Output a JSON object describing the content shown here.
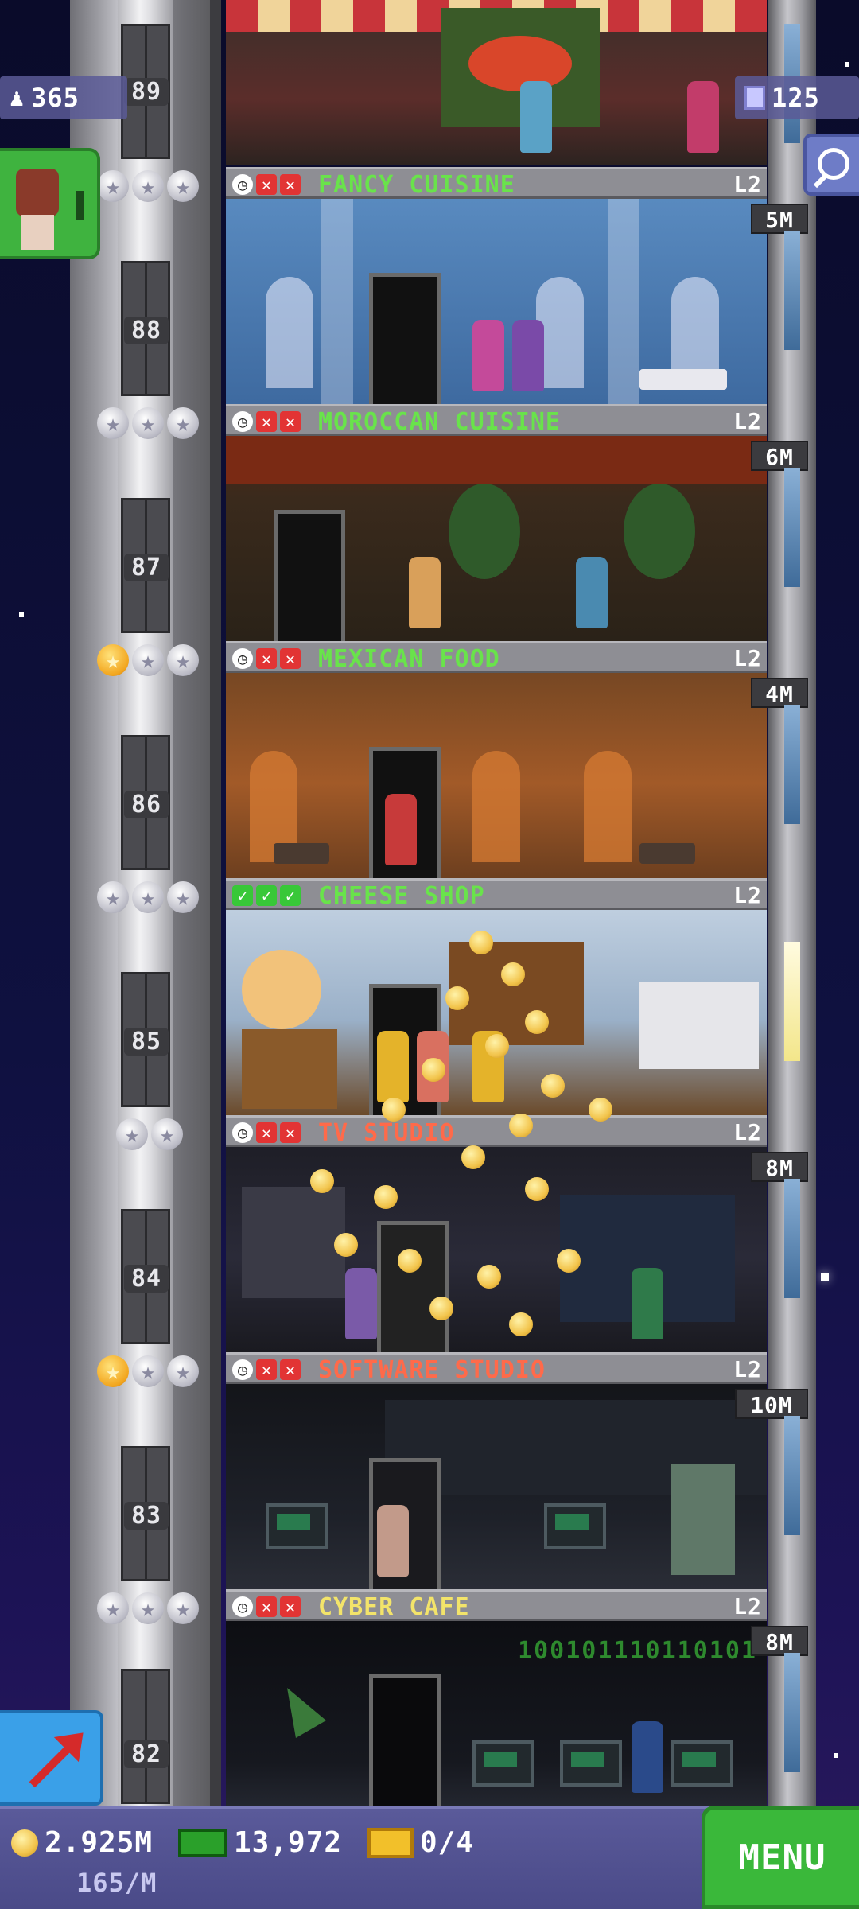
{
  "hud": {
    "population": "365",
    "bux": "125"
  },
  "floors": [
    {
      "number": "89"
    },
    {
      "number": "88",
      "name": "FANCY CUISINE",
      "level": "L2",
      "income": "5M",
      "status": [
        "clock",
        "x",
        "x"
      ],
      "stars": [
        "silver",
        "silver",
        "silver"
      ],
      "name_color": "green"
    },
    {
      "number": "87",
      "name": "MOROCCAN CUISINE",
      "level": "L2",
      "income": "6M",
      "status": [
        "clock",
        "x",
        "x"
      ],
      "stars": [
        "silver",
        "silver",
        "silver"
      ],
      "name_color": "green"
    },
    {
      "number": "86",
      "name": "MEXICAN FOOD",
      "level": "L2",
      "income": "4M",
      "status": [
        "clock",
        "x",
        "x"
      ],
      "stars": [
        "gold",
        "silver",
        "silver"
      ],
      "name_color": "green"
    },
    {
      "number": "85",
      "name": "CHEESE SHOP",
      "level": "L2",
      "income": "",
      "status": [
        "check",
        "check",
        "check"
      ],
      "stars": [
        "silver",
        "silver",
        "silver"
      ],
      "name_color": "green"
    },
    {
      "number": "84",
      "name": "TV STUDIO",
      "level": "L2",
      "income": "8M",
      "status": [
        "clock",
        "x",
        "x"
      ],
      "stars": [
        "silver",
        "silver"
      ],
      "name_color": "red"
    },
    {
      "number": "83",
      "name": "SOFTWARE STUDIO",
      "level": "L2",
      "income": "10M",
      "status": [
        "clock",
        "x",
        "x"
      ],
      "stars": [
        "gold",
        "silver",
        "silver"
      ],
      "name_color": "red"
    },
    {
      "number": "82",
      "name": "CYBER CAFE",
      "level": "L2",
      "income": "8M",
      "status": [
        "clock",
        "x",
        "x"
      ],
      "stars": [
        "silver",
        "silver",
        "silver"
      ],
      "name_color": "yellow"
    }
  ],
  "cyber_display": "100101110110101",
  "footer": {
    "coins": "2.925M",
    "coin_rate": "165/M",
    "bux": "13,972",
    "tickets": "0/4",
    "menu_label": "MENU"
  },
  "icons": {
    "population": "person-icon",
    "bux": "building-icon",
    "search": "magnifier-icon",
    "arrow": "red-arrow-icon",
    "coin": "coin-icon",
    "cash": "cash-icon",
    "ticket": "gold-ticket-icon"
  },
  "colors": {
    "green_name": "#69e34b",
    "red_name": "#ff6a4a",
    "yellow_name": "#f3e46a",
    "menu": "#3ab83a",
    "hud": "#5a5a9a"
  }
}
